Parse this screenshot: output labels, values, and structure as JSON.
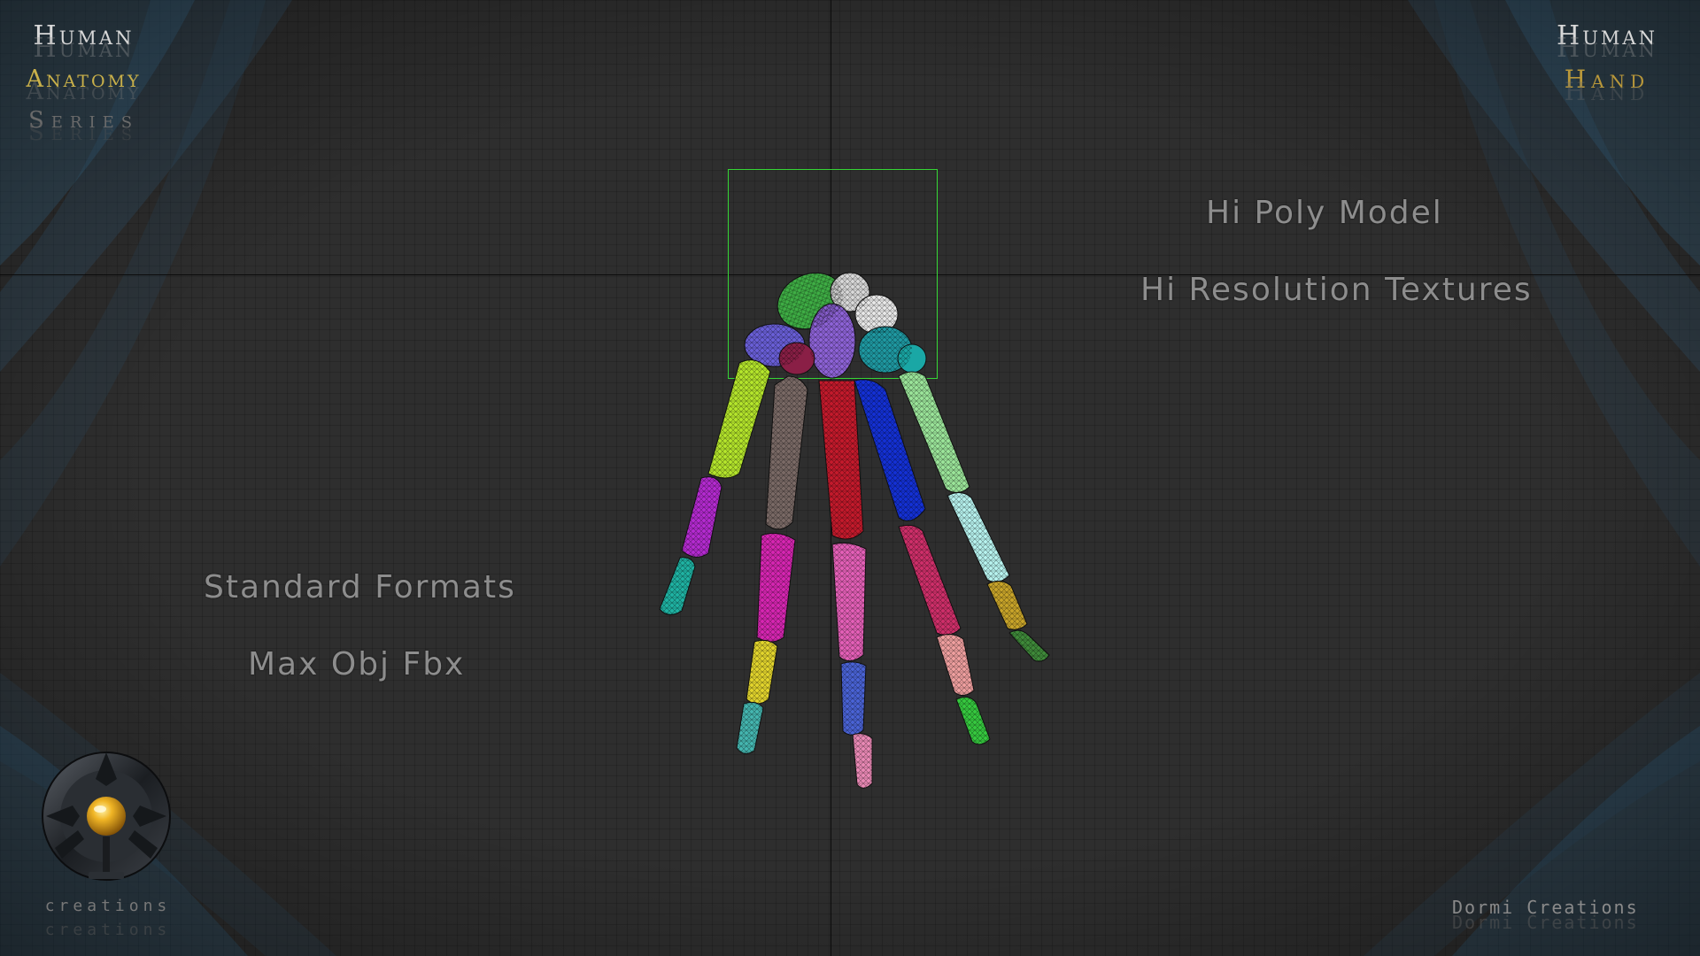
{
  "branding": {
    "left_title": {
      "line1": "Human",
      "line2": "Anatomy",
      "line3": "Series"
    },
    "right_title": {
      "line1": "Human",
      "line2": "Hand"
    },
    "logo_word": "creations",
    "credit": "Dormi Creations"
  },
  "features": {
    "hi_poly": "Hi Poly Model",
    "hi_res": "Hi Resolution Textures",
    "formats": "Standard Formats",
    "format_list": "Max Obj Fbx"
  },
  "colors": {
    "background": "#2e2e2e",
    "gizmo_box": "#35d635",
    "title_white": "#d8d8d8",
    "title_gold": "#c9b04a",
    "glow_blue": "#2f6f9a"
  },
  "icons": {
    "logo": "creations-emblem-icon"
  }
}
